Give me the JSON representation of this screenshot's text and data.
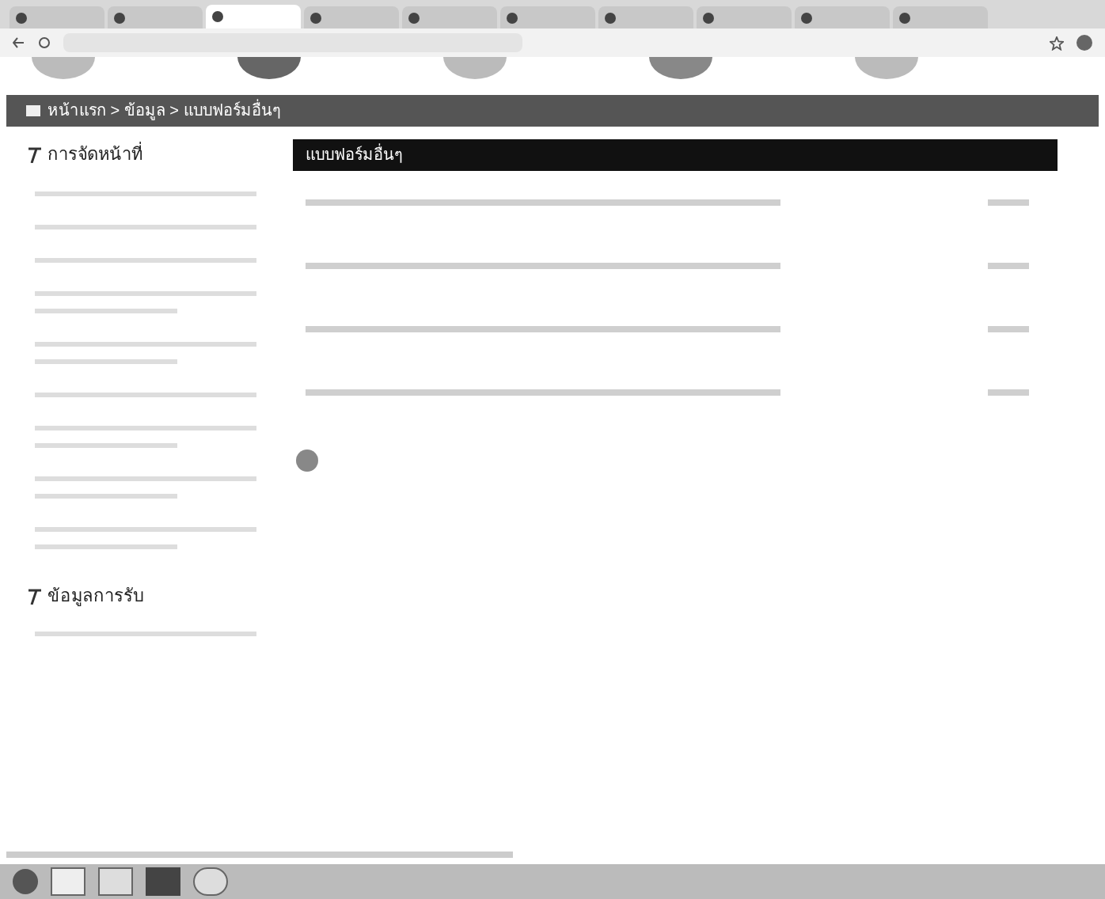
{
  "browser": {
    "tabs": [
      {
        "selected": false
      },
      {
        "selected": false
      },
      {
        "selected": true
      },
      {
        "selected": false
      },
      {
        "selected": false
      },
      {
        "selected": false
      },
      {
        "selected": false
      },
      {
        "selected": false
      },
      {
        "selected": false
      },
      {
        "selected": false
      }
    ]
  },
  "breadcrumb": "หน้าแรก > ข้อมูล > แบบฟอร์มอื่นๆ",
  "sidebar": {
    "sections": [
      {
        "title": "การจัดหน้าที่",
        "items": [
          {
            "kind": "one_line"
          },
          {
            "kind": "one_line"
          },
          {
            "kind": "one_line"
          },
          {
            "kind": "two_line"
          },
          {
            "kind": "two_line"
          },
          {
            "kind": "one_line"
          },
          {
            "kind": "two_line"
          },
          {
            "kind": "two_line"
          },
          {
            "kind": "two_line"
          }
        ]
      },
      {
        "title": "ข้อมูลการรับ",
        "items": [
          {
            "kind": "one_line"
          }
        ]
      }
    ]
  },
  "panel": {
    "title": "แบบฟอร์มอื่นๆ",
    "documents": [
      {
        "kind": "link"
      },
      {
        "kind": "link"
      },
      {
        "kind": "link"
      },
      {
        "kind": "link"
      }
    ]
  }
}
